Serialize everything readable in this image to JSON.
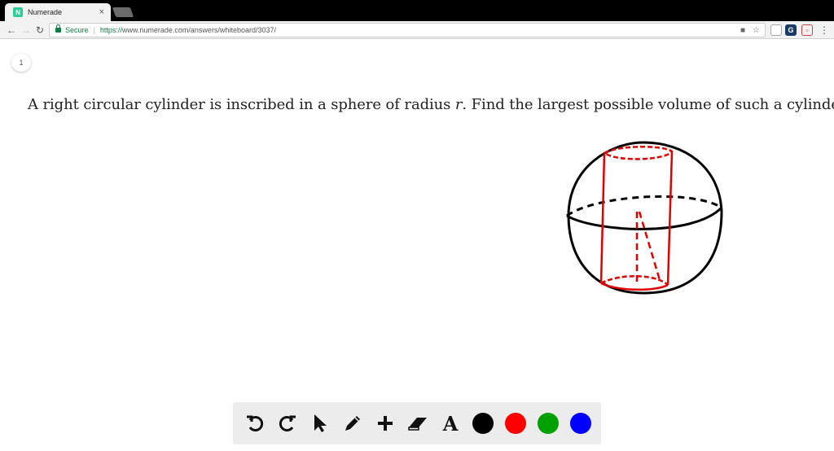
{
  "browser": {
    "tab_title": "Numerade",
    "tab_close": "×",
    "favicon_text": "N",
    "secure_label": "Secure",
    "url_protocol": "https://",
    "url_rest": "www.numerade.com/answers/whiteboard/3037/"
  },
  "page": {
    "page_number": "1",
    "question_before": "A right circular cylinder is inscribed in a sphere of radius ",
    "question_var": "r",
    "question_after": ". Find the largest possible volume of such a cylinder."
  },
  "tools": {
    "icons": [
      "undo-icon",
      "redo-icon",
      "pointer-icon",
      "pencil-icon",
      "plus-icon",
      "eraser-icon",
      "text-icon"
    ],
    "text_tool_label": "A",
    "colors": [
      "#000000",
      "#ff0000",
      "#00a000",
      "#0000ff"
    ]
  }
}
